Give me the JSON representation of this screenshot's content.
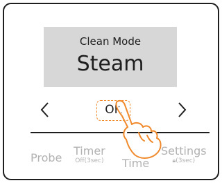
{
  "display": {
    "mode_label": "Clean Mode",
    "mode_value": "Steam"
  },
  "nav": {
    "left_icon": "chevron-left-icon",
    "right_icon": "chevron-right-icon",
    "ok_label": "OK"
  },
  "tabs": [
    {
      "label": "Probe",
      "sub": ""
    },
    {
      "label": "Timer",
      "sub": "Off(3sec)"
    },
    {
      "label": "C\nTime",
      "sub": ""
    },
    {
      "label": "Settings",
      "sub": "(3sec)",
      "sub_icon": "lock-icon"
    }
  ],
  "colors": {
    "display_bg": "#d7d7d7",
    "text": "#1e1e1e",
    "inactive_text": "#b2b2b2",
    "highlight": "#f08a2c"
  },
  "overlay": {
    "icon": "pointing-hand-icon"
  }
}
